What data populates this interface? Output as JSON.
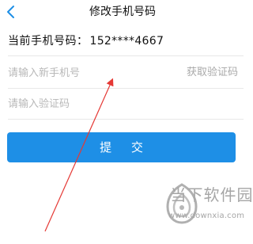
{
  "header": {
    "back_icon": "chevron-left-icon",
    "title": "修改手机号码"
  },
  "current_phone": {
    "label": "当前手机号码：",
    "value": "152****4667"
  },
  "new_phone_field": {
    "value": "",
    "placeholder": "请输入新手机号"
  },
  "get_code_label": "获取验证码",
  "code_field": {
    "value": "",
    "placeholder": "请输入验证码"
  },
  "submit_label": "提 交",
  "watermark": {
    "name": "当下软件园",
    "url": "www.downxia.com"
  },
  "colors": {
    "accent": "#1e8fe6",
    "arrow": "#e53935",
    "placeholder": "#b8b8b8",
    "watermark": "#a6a6a6"
  }
}
